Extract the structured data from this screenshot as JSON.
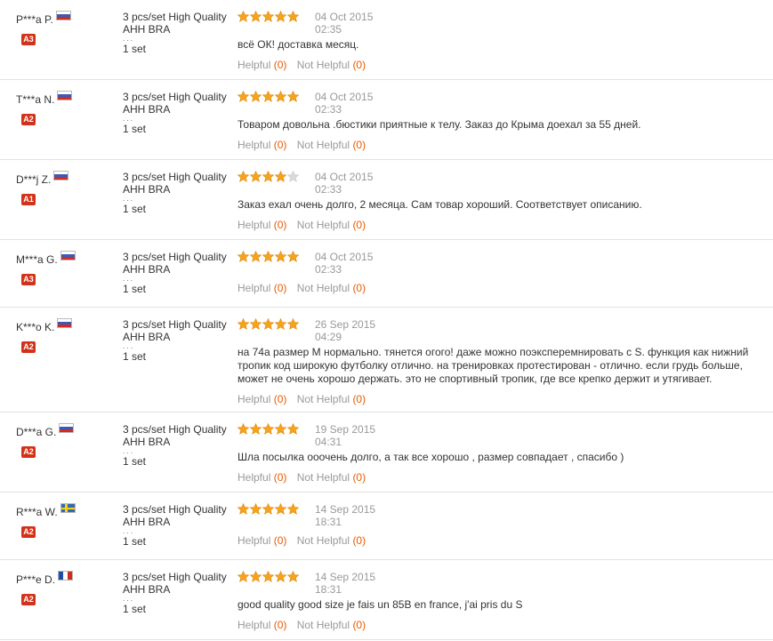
{
  "colors": {
    "star_full": "#f7a21d",
    "star_empty": "#d9d9d9",
    "badge": "#d3321a",
    "count": "#e85a00"
  },
  "labels": {
    "helpful": "Helpful",
    "not_helpful": "Not Helpful",
    "ellipsis": ". . ."
  },
  "reviews": [
    {
      "buyer": "P***a P.",
      "country": "russia-flag",
      "level": "A3",
      "product": "3 pcs/set High Quality AHH BRA",
      "qty": "1 set",
      "rating": 5,
      "date": "04 Oct 2015",
      "time": "02:35",
      "comment": "всё ОК! доставка месяц.",
      "helpful_count": "(0)",
      "not_helpful_count": "(0)"
    },
    {
      "buyer": "T***a N.",
      "country": "russia-flag",
      "level": "A2",
      "product": "3 pcs/set High Quality AHH BRA",
      "qty": "1 set",
      "rating": 5,
      "date": "04 Oct 2015",
      "time": "02:33",
      "comment": "Товаром довольна .бюстики приятные к телу. Заказ до Крыма доехал за 55 дней.",
      "helpful_count": "(0)",
      "not_helpful_count": "(0)"
    },
    {
      "buyer": "D***j Z.",
      "country": "russia-flag",
      "level": "A1",
      "product": "3 pcs/set High Quality AHH BRA",
      "qty": "1 set",
      "rating": 4,
      "date": "04 Oct 2015",
      "time": "02:33",
      "comment": "Заказ ехал очень долго, 2 месяца. Сам товар хороший. Соответствует описанию.",
      "helpful_count": "(0)",
      "not_helpful_count": "(0)"
    },
    {
      "buyer": "M***a G.",
      "country": "russia-flag",
      "level": "A3",
      "product": "3 pcs/set High Quality AHH BRA",
      "qty": "1 set",
      "rating": 5,
      "date": "04 Oct 2015",
      "time": "02:33",
      "comment": "",
      "helpful_count": "(0)",
      "not_helpful_count": "(0)"
    },
    {
      "buyer": "K***o K.",
      "country": "russia-flag",
      "level": "A2",
      "product": "3 pcs/set High Quality AHH BRA",
      "qty": "1 set",
      "rating": 5,
      "date": "26 Sep 2015",
      "time": "04:29",
      "comment": "на 74а размер М нормально. тянется огого! даже можно поэксперемнировать с S. функция как нижний тропик код широкую футболку отлично. на тренировках протестирован - отлично. если грудь больше, может не очень хорошо держать. это не спортивный тропик, где все крепко держит и утягивает.",
      "helpful_count": "(0)",
      "not_helpful_count": "(0)"
    },
    {
      "buyer": "D***a G.",
      "country": "russia-flag",
      "level": "A2",
      "product": "3 pcs/set High Quality AHH BRA",
      "qty": "1 set",
      "rating": 5,
      "date": "19 Sep 2015",
      "time": "04:31",
      "comment": "Шла посылка ооочень долго, а так все хорошо , размер совпадает , спасибо )",
      "helpful_count": "(0)",
      "not_helpful_count": "(0)"
    },
    {
      "buyer": "R***a W.",
      "country": "sweden-flag",
      "level": "A2",
      "product": "3 pcs/set High Quality AHH BRA",
      "qty": "1 set",
      "rating": 5,
      "date": "14 Sep 2015",
      "time": "18:31",
      "comment": "",
      "helpful_count": "(0)",
      "not_helpful_count": "(0)"
    },
    {
      "buyer": "P***e D.",
      "country": "france-flag",
      "level": "A2",
      "product": "3 pcs/set High Quality AHH BRA",
      "qty": "1 set",
      "rating": 5,
      "date": "14 Sep 2015",
      "time": "18:31",
      "comment": "good quality good size je fais un 85B en france, j'ai pris du S",
      "helpful_count": "(0)",
      "not_helpful_count": "(0)"
    }
  ]
}
